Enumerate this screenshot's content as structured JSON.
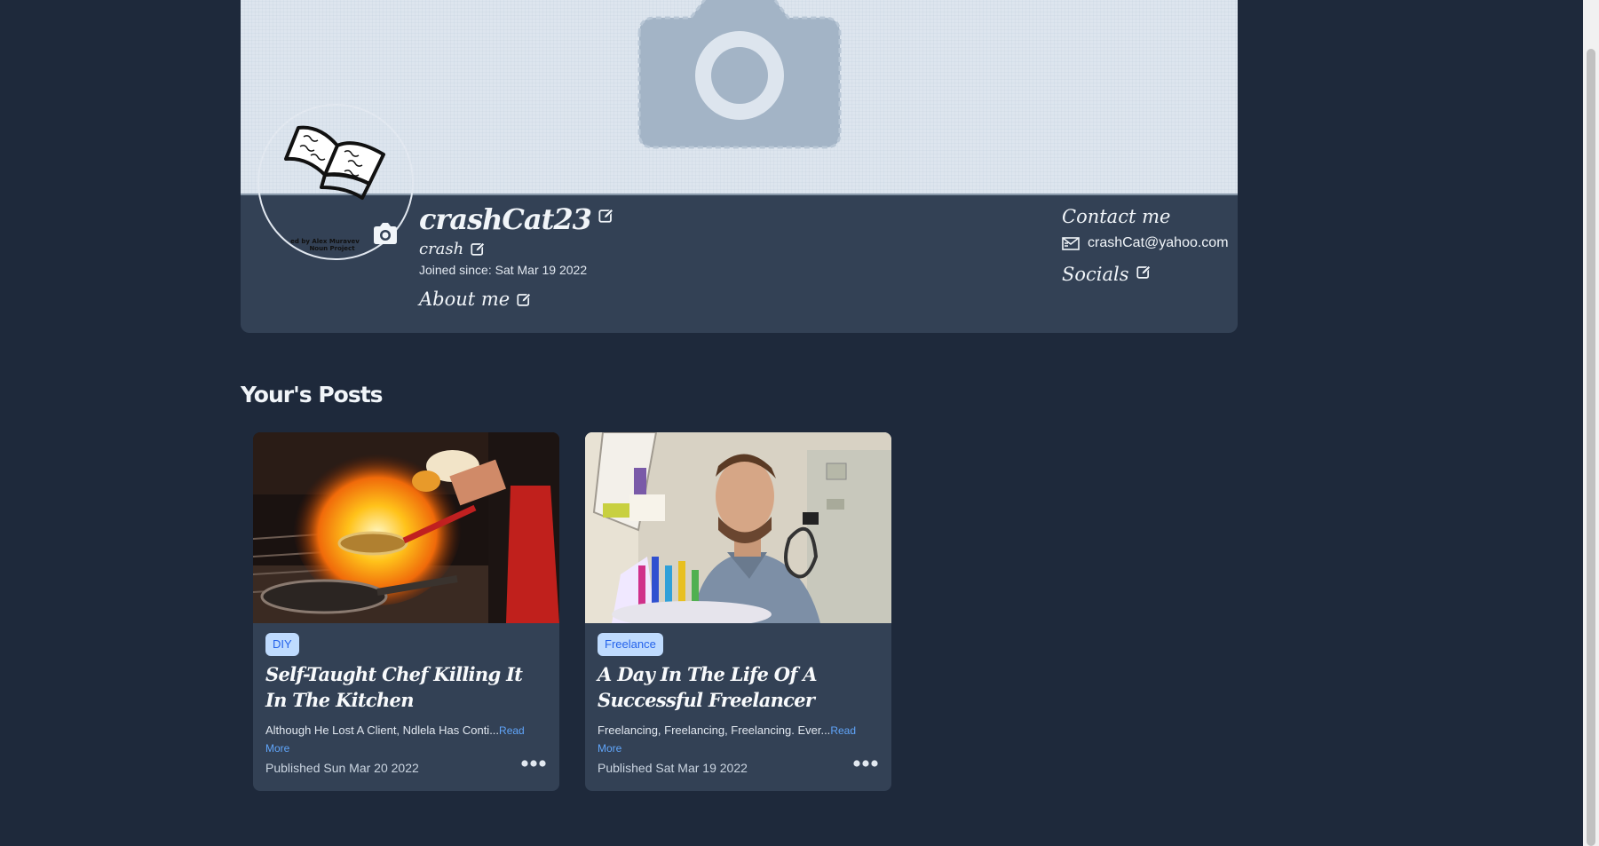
{
  "profile": {
    "username": "crashCat23",
    "nickname": "crash",
    "joined": "Joined since: Sat Mar 19 2022",
    "about_label": "About me",
    "avatar_caption_line1": "ed by Alex Muravev",
    "avatar_caption_line2": "Noun Project"
  },
  "contact": {
    "title": "Contact me",
    "email": "crashCat@yahoo.com",
    "socials_label": "Socials"
  },
  "posts_section": {
    "title": "Your's Posts"
  },
  "posts": [
    {
      "category": "DIY",
      "title": "Self-Taught Chef Killing It In The Kitchen",
      "excerpt": "Although He Lost A Client, Ndlela Has Conti...",
      "read_more": "Read More",
      "published": "Published Sun Mar 20 2022"
    },
    {
      "category": "Freelance",
      "title": "A Day In The Life Of A Successful Freelancer",
      "excerpt": "Freelancing, Freelancing, Freelancing. Ever...",
      "read_more": "Read More",
      "published": "Published Sat Mar 19 2022"
    }
  ],
  "colors": {
    "page_bg": "#1e293b",
    "card_bg": "#334155",
    "badge_bg": "#bfdbfe",
    "badge_text": "#2563eb",
    "link": "#60a5fa"
  },
  "icons": [
    "camera-icon",
    "edit-icon",
    "mail-icon",
    "more-dots-icon",
    "book-icon"
  ]
}
